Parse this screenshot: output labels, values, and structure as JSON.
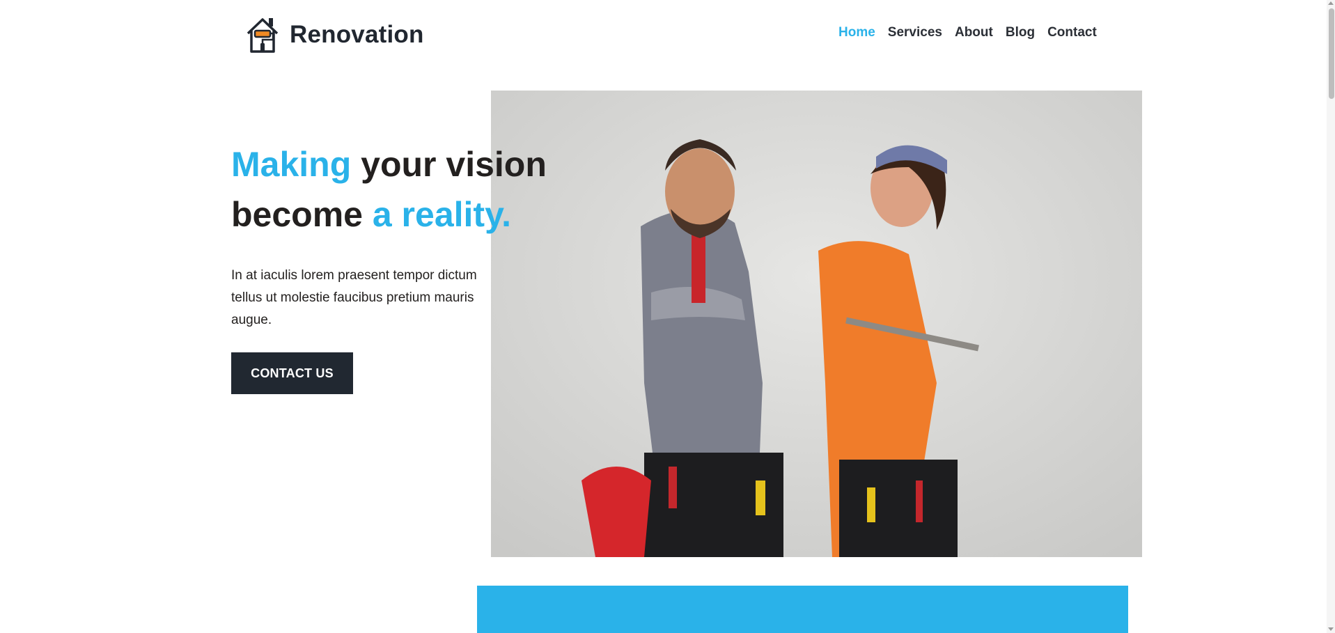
{
  "brand": {
    "name": "Renovation",
    "icon": "house-paint-roller-icon"
  },
  "nav": {
    "items": [
      {
        "label": "Home",
        "active": true
      },
      {
        "label": "Services",
        "active": false
      },
      {
        "label": "About",
        "active": false
      },
      {
        "label": "Blog",
        "active": false
      },
      {
        "label": "Contact",
        "active": false
      }
    ]
  },
  "hero": {
    "title_part1": "Making",
    "title_part2": " your vision",
    "title_part3": "become ",
    "title_part4": "a reality.",
    "description": "In at iaculis lorem praesent tempor dictum tellus ut molestie faucibus pretium mauris augue.",
    "cta_label": "CONTACT US",
    "image": "two-smiling-workers-in-overalls-with-tool-belts"
  },
  "colors": {
    "accent": "#2ab2e9",
    "dark": "#212831",
    "text": "#23201f"
  }
}
